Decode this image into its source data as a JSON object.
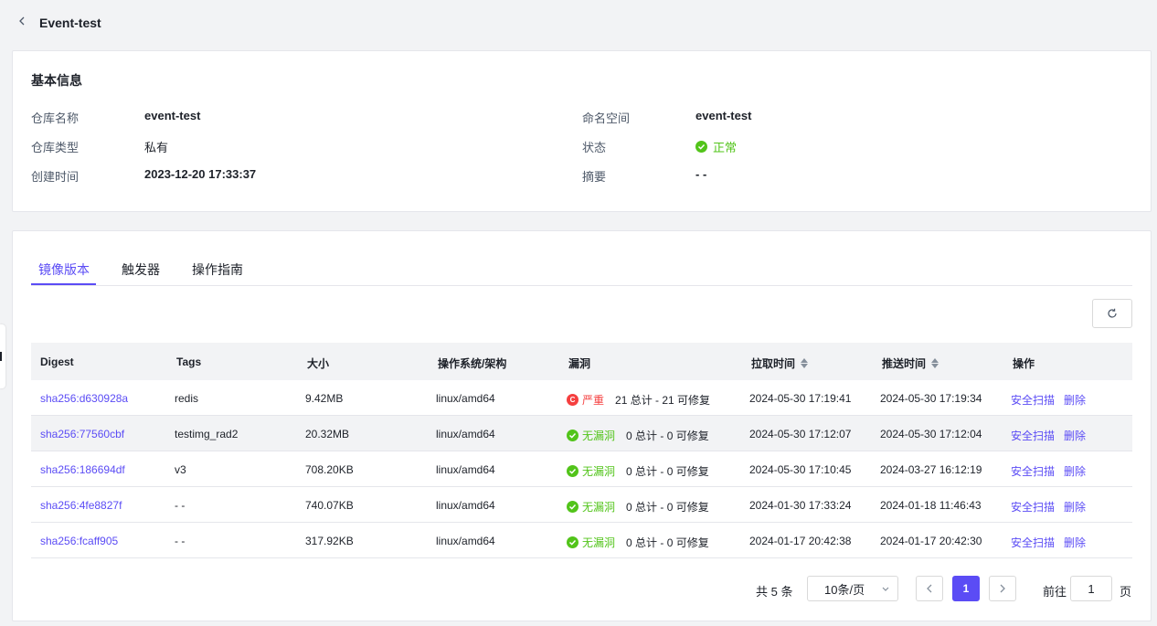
{
  "header": {
    "title": "Event-test"
  },
  "basic_info": {
    "section_title": "基本信息",
    "fields": [
      {
        "label": "仓库名称",
        "value": "event-test"
      },
      {
        "label": "仓库类型",
        "value": "私有"
      },
      {
        "label": "创建时间",
        "value": "2023-12-20 17:33:37"
      },
      {
        "label": "命名空间",
        "value": "event-test"
      },
      {
        "label": "状态",
        "value": "正常"
      },
      {
        "label": "摘要",
        "value": "- -"
      }
    ]
  },
  "tabs": [
    {
      "label": "镜像版本",
      "active": true
    },
    {
      "label": "触发器",
      "active": false
    },
    {
      "label": "操作指南",
      "active": false
    }
  ],
  "table": {
    "columns": [
      "Digest",
      "Tags",
      "大小",
      "操作系统/架构",
      "漏洞",
      "拉取时间",
      "推送时间",
      "操作"
    ],
    "rows": [
      {
        "digest": "sha256:d630928a",
        "tags": "redis",
        "size": "9.42MB",
        "os": "linux/amd64",
        "vuln_status": "严重",
        "vuln_icon": "C",
        "vuln_level": "critical",
        "vuln_count": "21 总计 - 21 可修复",
        "pulled": "2024-05-30 17:19:41",
        "pushed": "2024-05-30 17:19:34",
        "op_scan": "安全扫描",
        "op_delete": "删除"
      },
      {
        "digest": "sha256:77560cbf",
        "tags": "testimg_rad2",
        "size": "20.32MB",
        "os": "linux/amd64",
        "vuln_status": "无漏洞",
        "vuln_level": "none",
        "vuln_count": "0 总计 - 0 可修复",
        "pulled": "2024-05-30 17:12:07",
        "pushed": "2024-05-30 17:12:04",
        "op_scan": "安全扫描",
        "op_delete": "删除"
      },
      {
        "digest": "sha256:186694df",
        "tags": "v3",
        "size": "708.20KB",
        "os": "linux/amd64",
        "vuln_status": "无漏洞",
        "vuln_level": "none",
        "vuln_count": "0 总计 - 0 可修复",
        "pulled": "2024-05-30 17:10:45",
        "pushed": "2024-03-27 16:12:19",
        "op_scan": "安全扫描",
        "op_delete": "删除"
      },
      {
        "digest": "sha256:4fe8827f",
        "tags": "- -",
        "size": "740.07KB",
        "os": "linux/amd64",
        "vuln_status": "无漏洞",
        "vuln_level": "none",
        "vuln_count": "0 总计 - 0 可修复",
        "pulled": "2024-01-30 17:33:24",
        "pushed": "2024-01-18 11:46:43",
        "op_scan": "安全扫描",
        "op_delete": "删除"
      },
      {
        "digest": "sha256:fcaff905",
        "tags": "- -",
        "size": "317.92KB",
        "os": "linux/amd64",
        "vuln_status": "无漏洞",
        "vuln_level": "none",
        "vuln_count": "0 总计 - 0 可修复",
        "pulled": "2024-01-17 20:42:38",
        "pushed": "2024-01-17 20:42:30",
        "op_scan": "安全扫描",
        "op_delete": "删除"
      }
    ]
  },
  "pagination": {
    "total": "共 5 条",
    "page_size": "10条/页",
    "current_page": "1",
    "goto_label": "前往",
    "goto_value": "1",
    "goto_suffix": "页"
  },
  "colors": {
    "accent": "#5b4cf5",
    "success": "#52c41a",
    "danger": "#f53f3f"
  },
  "icons": {
    "back": "chevron-left-icon",
    "refresh": "refresh-icon",
    "sort": "sort-icon",
    "status_ok": "check-circle-icon"
  }
}
